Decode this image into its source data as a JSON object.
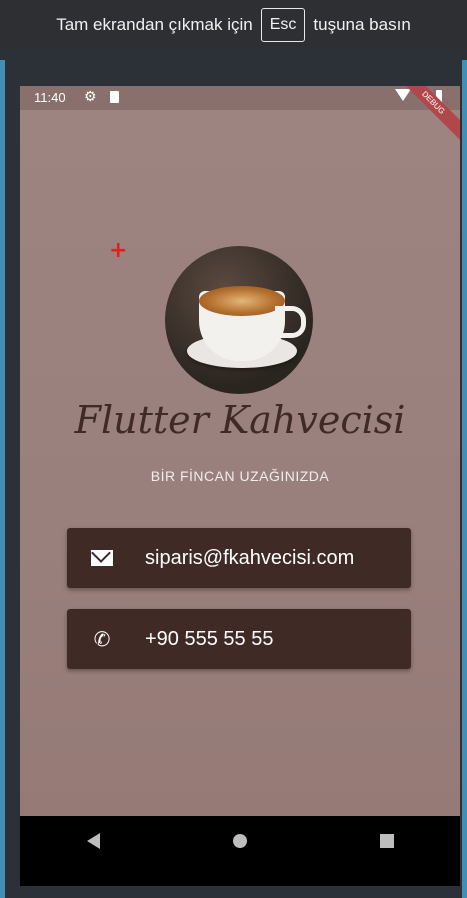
{
  "banner": {
    "text_before": "Tam ekrandan çıkmak için",
    "key": "Esc",
    "text_after": "tuşuna basın"
  },
  "status_bar": {
    "time": "11:40",
    "icons": [
      "gear-icon",
      "sd-card-icon",
      "wifi-icon",
      "battery-icon"
    ],
    "debug_label": "DEBUG"
  },
  "app": {
    "title": "Flutter Kahvecisi",
    "subtitle": "BİR FİNCAN UZAĞINIZDA",
    "email": {
      "icon": "mail-icon",
      "value": "siparis@fkahvecisi.com"
    },
    "phone": {
      "icon": "phone-icon",
      "value": "+90 555 55 55"
    }
  },
  "colors": {
    "background": "#9e8480",
    "card": "#3f2a26",
    "title": "#3f2a26"
  },
  "navbar": {
    "icons": [
      "back-icon",
      "home-icon",
      "recents-icon"
    ]
  }
}
